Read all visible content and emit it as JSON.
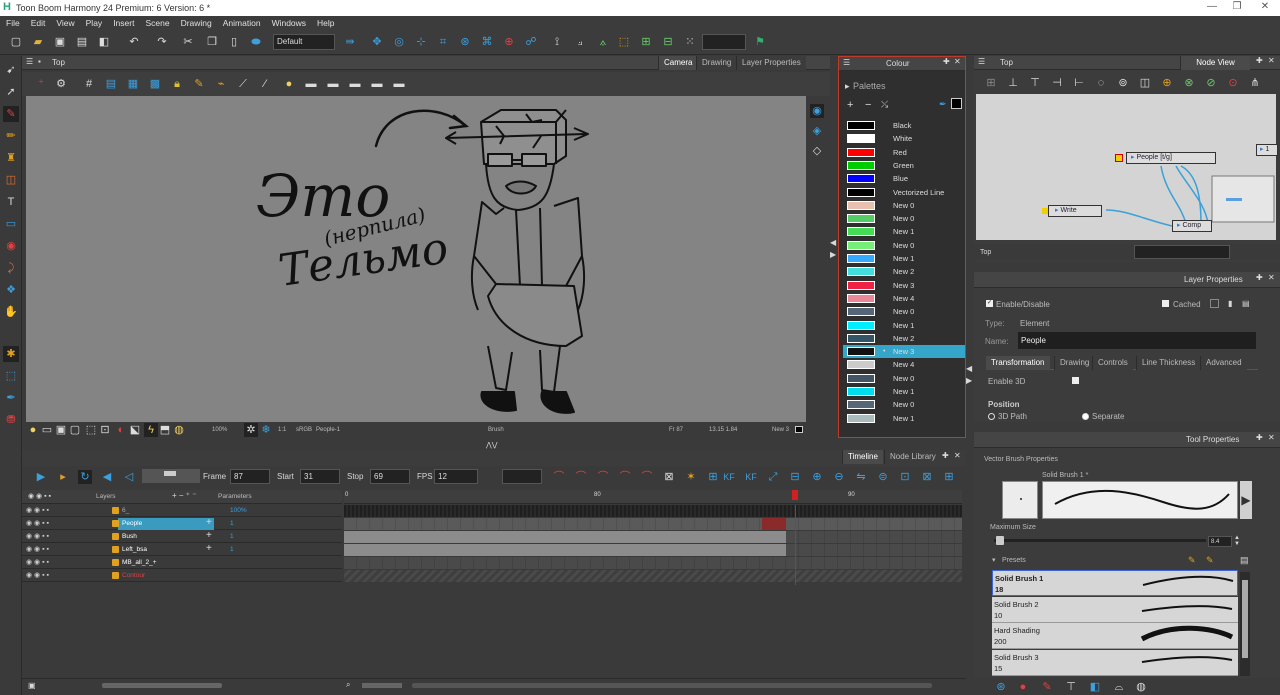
{
  "window": {
    "title": "Toon Boom Harmony 24 Premium: 6 Version: 6 *",
    "minimize": "—",
    "maximize": "❐",
    "close": "✕"
  },
  "menu": [
    "File",
    "Edit",
    "View",
    "Play",
    "Insert",
    "Scene",
    "Drawing",
    "Animation",
    "Windows",
    "Help"
  ],
  "toolbar": {
    "workspace_select": "Default"
  },
  "camera": {
    "header_label": "Top",
    "tabs": [
      "Camera",
      "Drawing",
      "Layer Properties"
    ],
    "drawing_text": [
      "Это",
      "(нерпила)",
      "Тельмо"
    ],
    "status": {
      "zoom": "100%",
      "ratio": "1:1",
      "colorspace": "sRGB",
      "layer": "People-1",
      "tool": "Brush",
      "frame": "Fr 87",
      "coords": "13.15 1.84",
      "colour": "New 3"
    }
  },
  "colour": {
    "title": "Colour",
    "palettes_label": "Palettes",
    "swatches": [
      {
        "name": "Black",
        "color": "#000000"
      },
      {
        "name": "White",
        "color": "#ffffff"
      },
      {
        "name": "Red",
        "color": "#ff0000"
      },
      {
        "name": "Green",
        "color": "#00cc00"
      },
      {
        "name": "Blue",
        "color": "#0000ff"
      },
      {
        "name": "Vectorized Line",
        "color": "#000000"
      },
      {
        "name": "New 0",
        "color": "#e8c0b0"
      },
      {
        "name": "New 0",
        "color": "#55cc66"
      },
      {
        "name": "New 1",
        "color": "#44dd55"
      },
      {
        "name": "New 0",
        "color": "#77ee77"
      },
      {
        "name": "New 1",
        "color": "#33aaff"
      },
      {
        "name": "New 2",
        "color": "#44dddd"
      },
      {
        "name": "New 3",
        "color": "#ee2244"
      },
      {
        "name": "New 4",
        "color": "#e88899"
      },
      {
        "name": "New 0",
        "color": "#556677"
      },
      {
        "name": "New 1",
        "color": "#00eeff"
      },
      {
        "name": "New 2",
        "color": "#335566"
      },
      {
        "name": "New 3",
        "color": "#111111"
      },
      {
        "name": "New 4",
        "color": "#cccccc"
      },
      {
        "name": "New 0",
        "color": "#445566"
      },
      {
        "name": "New 1",
        "color": "#00ddee"
      },
      {
        "name": "New 0",
        "color": "#556677"
      },
      {
        "name": "New 1",
        "color": "#aabbbb"
      }
    ],
    "selected_index": 17
  },
  "nodeview": {
    "header_label": "Top",
    "tab": "Node View",
    "nodes": {
      "people": "People [t/g]",
      "write": "Write",
      "comp": "Comp",
      "one": "1"
    },
    "footer": "Top"
  },
  "layer_properties": {
    "title": "Layer Properties",
    "enable_label": "Enable/Disable",
    "cached_label": "Cached",
    "type_label": "Type:",
    "type_value": "Element",
    "name_label": "Name:",
    "name_value": "People",
    "tabs": [
      "Transformation",
      "Drawing",
      "Controls",
      "Line Thickness",
      "Advanced"
    ],
    "enable3d": "Enable 3D",
    "position": "Position",
    "path3d": "3D Path",
    "separate": "Separate"
  },
  "tool_properties": {
    "title": "Tool Properties",
    "section": "Vector Brush Properties",
    "brush_name": "Solid Brush 1 *",
    "max_size_label": "Maximum Size",
    "max_size_value": "8.4",
    "presets_label": "Presets",
    "presets": [
      {
        "name": "Solid Brush 1",
        "size": "18"
      },
      {
        "name": "Solid Brush 2",
        "size": "10"
      },
      {
        "name": "Hard Shading",
        "size": "200"
      },
      {
        "name": "Solid Brush 3",
        "size": "15"
      }
    ]
  },
  "timeline": {
    "tabs": [
      "Timeline",
      "Node Library"
    ],
    "frame_label": "Frame",
    "frame_value": "87",
    "start_label": "Start",
    "start_value": "31",
    "stop_label": "Stop",
    "stop_value": "69",
    "fps_label": "FPS",
    "fps_value": "12",
    "col_layers": "Layers",
    "col_params": "Parameters",
    "ruler": [
      "0",
      "80",
      "90"
    ],
    "layers": [
      {
        "name": "6_",
        "param": "100%",
        "color": "#aaa"
      },
      {
        "name": "People",
        "param": "1",
        "color": "#fff"
      },
      {
        "name": "Bush",
        "param": "1",
        "color": "#fff"
      },
      {
        "name": "Left_bsa",
        "param": "1",
        "color": "#fff"
      },
      {
        "name": "MB_all_2_+",
        "param": "",
        "color": "#fff"
      },
      {
        "name": "Contour",
        "param": "",
        "color": "#e04040"
      }
    ]
  }
}
